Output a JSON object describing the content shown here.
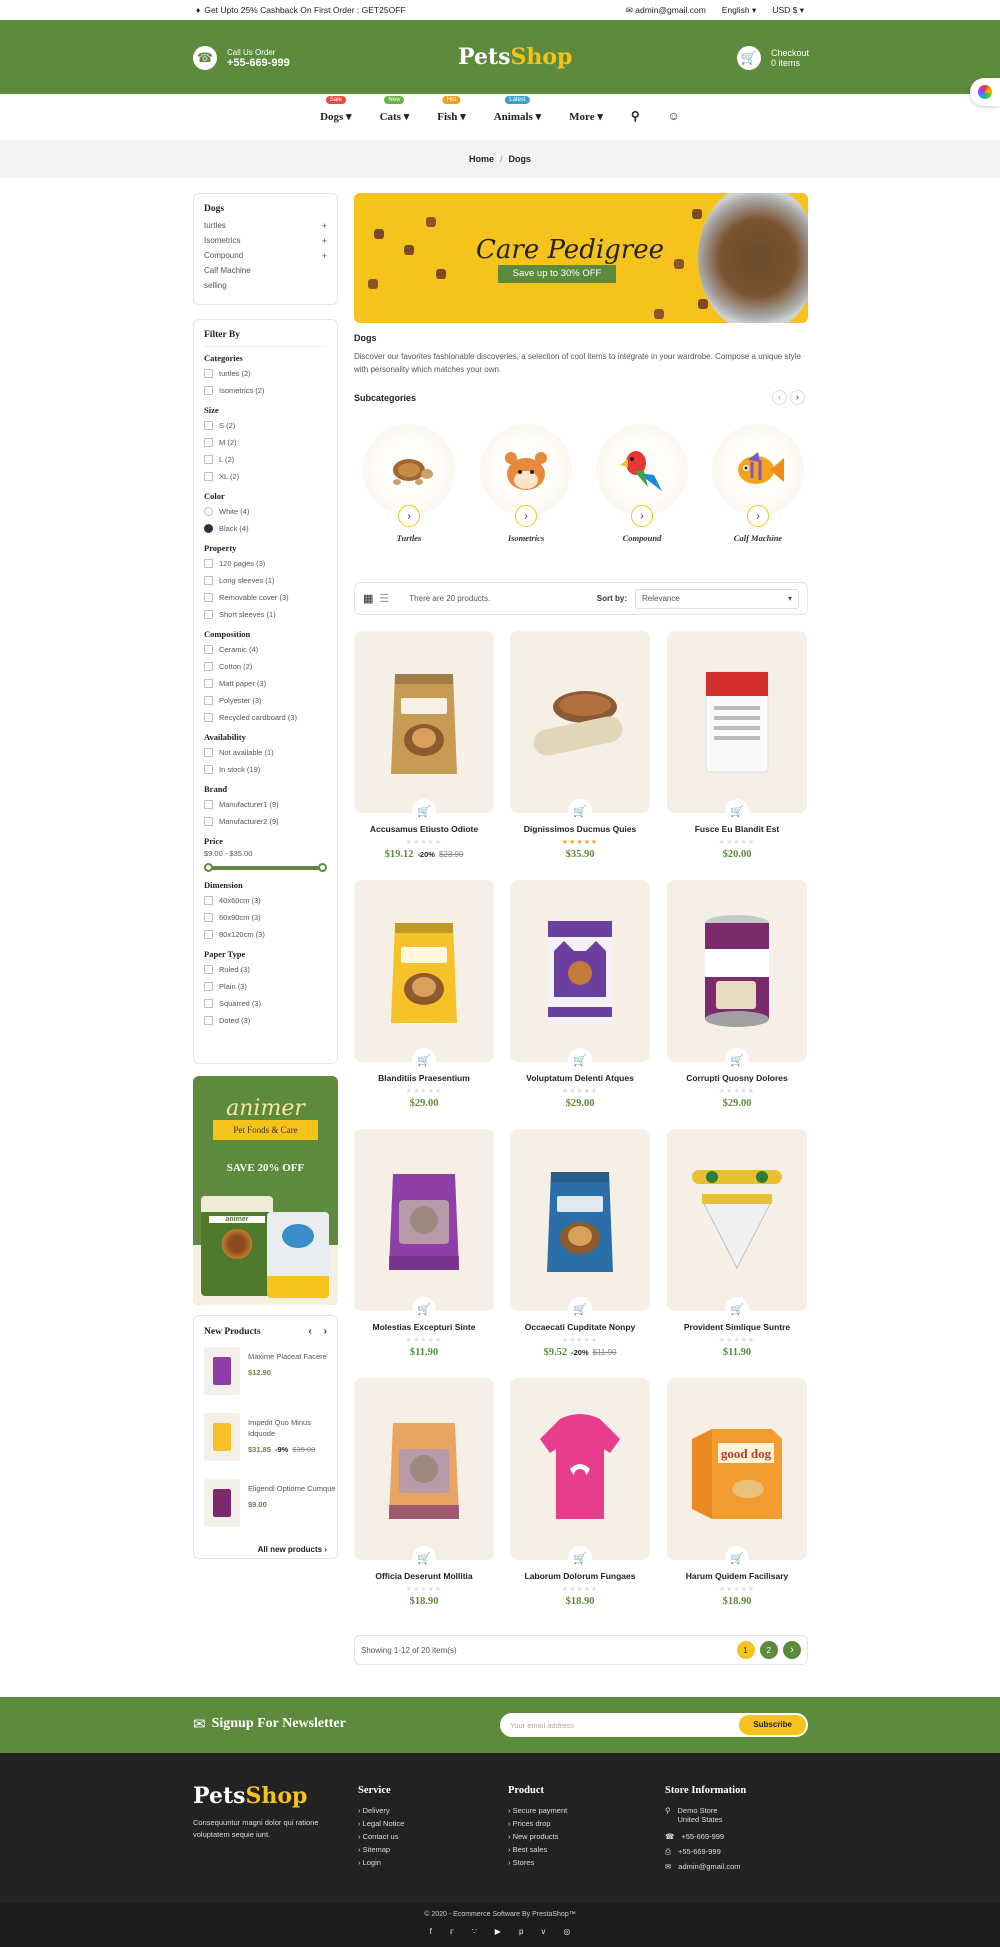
{
  "topbar": {
    "promo": "Get Upto 25% Cashback On First Order : GET25OFF",
    "email": "admin@gmail.com",
    "language": "English",
    "currency": "USD $"
  },
  "header": {
    "call_label": "Call Us Order",
    "phone": "+55-669-999",
    "logo_a": "Pets",
    "logo_b": "Shop",
    "checkout_label": "Checkout",
    "cart_count": "0 items"
  },
  "nav": {
    "items": [
      {
        "label": "Dogs",
        "badge": "Sale",
        "color": "#e74c3c"
      },
      {
        "label": "Cats",
        "badge": "New",
        "color": "#6ab04c"
      },
      {
        "label": "Fish",
        "badge": "Hot",
        "color": "#f0a020"
      },
      {
        "label": "Animals",
        "badge": "Latest",
        "color": "#3fa0d0"
      },
      {
        "label": "More",
        "badge": "",
        "color": ""
      }
    ]
  },
  "breadcrumb": {
    "home": "Home",
    "sep": "/",
    "current": "Dogs"
  },
  "sidebar": {
    "title": "Dogs",
    "cats": [
      {
        "label": "turtles",
        "plus": "+"
      },
      {
        "label": "Isometrics",
        "plus": "+"
      },
      {
        "label": "Compound",
        "plus": "+"
      },
      {
        "label": "Calf Machine",
        "plus": ""
      },
      {
        "label": "selling",
        "plus": ""
      }
    ],
    "filter_title": "Filter By",
    "groups": [
      {
        "title": "Categories",
        "type": "cb",
        "opts": [
          "turtles (2)",
          "Isometrics (2)"
        ]
      },
      {
        "title": "Size",
        "type": "cb",
        "opts": [
          "S (2)",
          "M (2)",
          "L (2)",
          "XL (2)"
        ]
      },
      {
        "title": "Color",
        "type": "color",
        "opts": [
          "White (4)",
          "Black (4)"
        ]
      },
      {
        "title": "Property",
        "type": "cb",
        "opts": [
          "120 pages (3)",
          "Long sleeves (1)",
          "Removable cover (3)",
          "Short sleeves (1)"
        ]
      },
      {
        "title": "Composition",
        "type": "cb",
        "opts": [
          "Ceramic (4)",
          "Cotton (2)",
          "Matt paper (3)",
          "Polyester (3)",
          "Recycled cardboard (3)"
        ]
      },
      {
        "title": "Availability",
        "type": "cb",
        "opts": [
          "Not available (1)",
          "In stock (19)"
        ]
      },
      {
        "title": "Brand",
        "type": "cb",
        "opts": [
          "Manufacturer1 (9)",
          "Manufacturer2 (9)"
        ]
      },
      {
        "title": "Price",
        "type": "price",
        "opts": []
      },
      {
        "title": "Dimension",
        "type": "cb",
        "opts": [
          "40x60cm (3)",
          "60x90cm (3)",
          "80x120cm (3)"
        ]
      },
      {
        "title": "Paper Type",
        "type": "cb",
        "opts": [
          "Ruled (3)",
          "Plain (3)",
          "Squarred (3)",
          "Doted (3)"
        ]
      }
    ],
    "price_range": "$9.00 - $35.00",
    "promo": {
      "brand": "animer",
      "tag": "Pet Foods & Care",
      "offer": "SAVE 20% OFF",
      "bag": "animer"
    },
    "new_products": {
      "title": "New Products",
      "items": [
        {
          "name": "Maxime Placeat Facere",
          "price": "$12.90",
          "disc": "",
          "old": ""
        },
        {
          "name": "Impedit Quo Minus Idquode",
          "price": "$31.85",
          "disc": "-9%",
          "old": "$35.00"
        },
        {
          "name": "Eligendi Optiome Cumque",
          "price": "$9.00",
          "disc": "",
          "old": ""
        }
      ],
      "all": "All new products ›"
    }
  },
  "banner": {
    "title": "Care Pedigree",
    "sub": "Save up to 30% OFF"
  },
  "category": {
    "title": "Dogs",
    "desc": "Discover our favorites fashionable discoveries, a selection of cool items to integrate in your wardrobe. Compose a unique style with personality which matches your own.",
    "sub_title": "Subcategories"
  },
  "subcats": [
    {
      "name": "Turtles",
      "icon": "turtle"
    },
    {
      "name": "Isometrics",
      "icon": "hamster"
    },
    {
      "name": "Compound",
      "icon": "parrot"
    },
    {
      "name": "Calf Machine",
      "icon": "fish"
    }
  ],
  "toolbar": {
    "count": "There are 20 products.",
    "sort_label": "Sort by:",
    "sort_value": "Relevance"
  },
  "products": [
    {
      "name": "Accusamus Etiusto Odiote",
      "price": "$19.12",
      "disc": "-20%",
      "old": "$23.90",
      "rated": false,
      "color": "#c89b54",
      "icon": "dog-food-bag"
    },
    {
      "name": "Dignissimos Ducmus Quies",
      "price": "$35.90",
      "disc": "",
      "old": "",
      "rated": true,
      "color": "#e8a45a",
      "icon": "wet-food-tray"
    },
    {
      "name": "Fusce Eu Blandit Est",
      "price": "$20.00",
      "disc": "",
      "old": "",
      "rated": false,
      "color": "#d32f2f",
      "icon": "food-bag"
    },
    {
      "name": "Blanditiis Praesentium",
      "price": "$29.00",
      "disc": "",
      "old": "",
      "rated": false,
      "color": "#f5c22a",
      "icon": "dog-food-bag"
    },
    {
      "name": "Voluptatum Delenti Atques",
      "price": "$29.00",
      "disc": "",
      "old": "",
      "rated": false,
      "color": "#6a3fa0",
      "icon": "cat-food-pouch"
    },
    {
      "name": "Corrupti Quosny Dolores",
      "price": "$29.00",
      "disc": "",
      "old": "",
      "rated": false,
      "color": "#7b2a6e",
      "icon": "pet-food-can"
    },
    {
      "name": "Molestias Excepturi Sinte",
      "price": "$11.90",
      "disc": "",
      "old": "",
      "rated": false,
      "color": "#8e3fa8",
      "icon": "cat-food-bag"
    },
    {
      "name": "Occaecati Cupditate Nonpy",
      "price": "$9.52",
      "disc": "-20%",
      "old": "$11.90",
      "rated": false,
      "color": "#2a6fa8",
      "icon": "dog-food-bag"
    },
    {
      "name": "Provident Simlique Suntre",
      "price": "$11.90",
      "disc": "",
      "old": "",
      "rated": false,
      "color": "#e8c030",
      "icon": "dog-collar"
    },
    {
      "name": "Officia Deserunt Mollitia",
      "price": "$18.90",
      "disc": "",
      "old": "",
      "rated": false,
      "color": "#e8a460",
      "icon": "cat-food-bag"
    },
    {
      "name": "Laborum Dolorum Fungaes",
      "price": "$18.90",
      "disc": "",
      "old": "",
      "rated": false,
      "color": "#e83c8c",
      "icon": "pet-hoodie"
    },
    {
      "name": "Harum Quidem Facilisary",
      "price": "$18.90",
      "disc": "",
      "old": "",
      "rated": false,
      "color": "#f0a030",
      "icon": "treat-box"
    }
  ],
  "product_img_text": {
    "box": "good dog",
    "can": "Pet Food",
    "hoodie_mark": "paw"
  },
  "pagination": {
    "info": "Showing 1-12 of 20 item(s)",
    "pages": [
      "1",
      "2"
    ],
    "next": "›"
  },
  "newsletter": {
    "title": "Signup For Newsletter",
    "placeholder": "Your email address",
    "button": "Subscribe"
  },
  "footer": {
    "logo_a": "Pets",
    "logo_b": "Shop",
    "about": "Consequuntur magni dolor qui ratione voluptatem sequie iunt.",
    "service": {
      "title": "Service",
      "links": [
        "Delivery",
        "Legal Notice",
        "Contact us",
        "Sitemap",
        "Login"
      ]
    },
    "product": {
      "title": "Product",
      "links": [
        "Secure payment",
        "Prices drop",
        "New products",
        "Best sales",
        "Stores"
      ]
    },
    "store": {
      "title": "Store Information",
      "address1": "Demo Store",
      "address2": "United States",
      "phone": "+55-669-999",
      "fax": "+55-669-999",
      "email": "admin@gmail.com"
    },
    "copyright": "© 2020 - Ecommerce Software By PrestaShop™"
  }
}
